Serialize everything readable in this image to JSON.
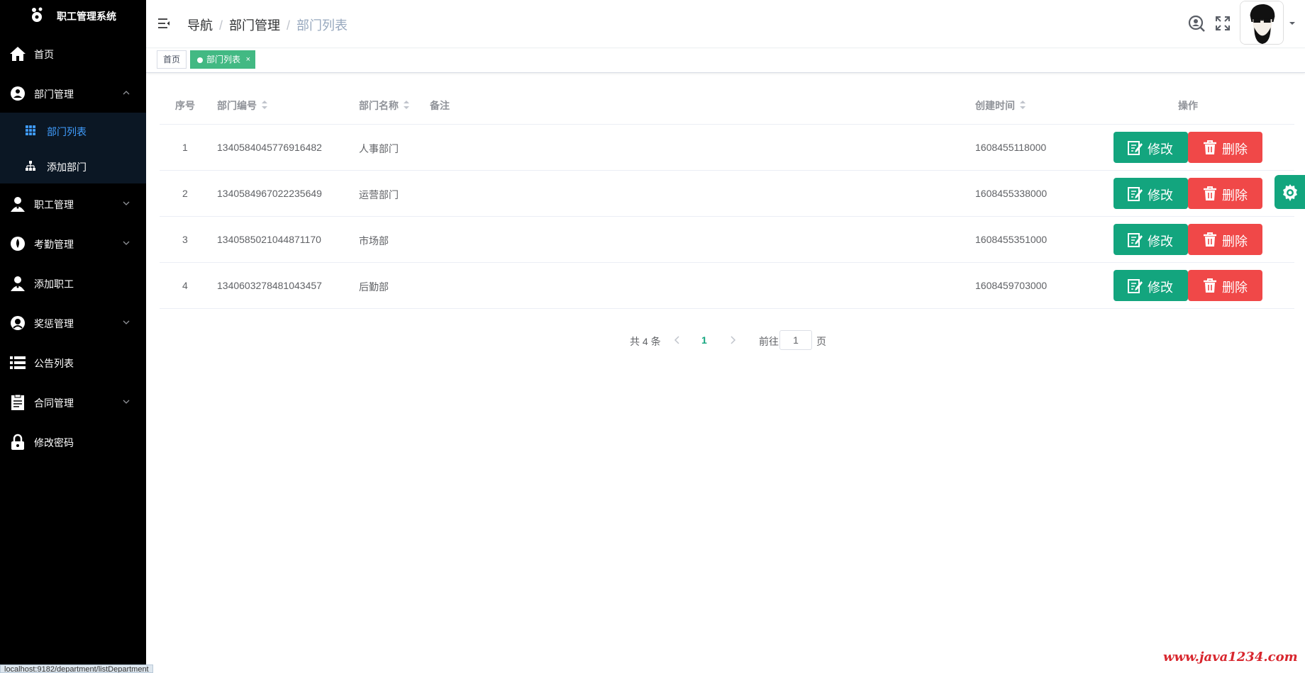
{
  "app": {
    "title": "职工管理系统"
  },
  "sidebar": {
    "items": [
      {
        "label": "首页",
        "icon": "home-icon"
      },
      {
        "label": "部门管理",
        "icon": "department-icon",
        "expanded": true,
        "children": [
          {
            "label": "部门列表",
            "icon": "grid-icon",
            "active": true
          },
          {
            "label": "添加部门",
            "icon": "org-tree-icon"
          }
        ]
      },
      {
        "label": "职工管理",
        "icon": "user-icon"
      },
      {
        "label": "考勤管理",
        "icon": "attendance-icon"
      },
      {
        "label": "添加职工",
        "icon": "user-icon"
      },
      {
        "label": "奖惩管理",
        "icon": "reward-icon"
      },
      {
        "label": "公告列表",
        "icon": "list-icon"
      },
      {
        "label": "合同管理",
        "icon": "contract-icon"
      },
      {
        "label": "修改密码",
        "icon": "lock-icon"
      }
    ]
  },
  "header": {
    "breadcrumb": [
      "导航",
      "部门管理",
      "部门列表"
    ]
  },
  "tags": {
    "home": "首页",
    "active": "部门列表",
    "close": "×"
  },
  "table": {
    "headers": {
      "index": "序号",
      "code": "部门编号",
      "name": "部门名称",
      "remark": "备注",
      "created": "创建时间",
      "actions": "操作"
    },
    "rows": [
      {
        "index": "1",
        "code": "1340584045776916482",
        "name": "人事部门",
        "remark": "",
        "created": "1608455118000"
      },
      {
        "index": "2",
        "code": "1340584967022235649",
        "name": "运营部门",
        "remark": "",
        "created": "1608455338000"
      },
      {
        "index": "3",
        "code": "1340585021044871170",
        "name": "市场部",
        "remark": "",
        "created": "1608455351000"
      },
      {
        "index": "4",
        "code": "1340603278481043457",
        "name": "后勤部",
        "remark": "",
        "created": "1608459703000"
      }
    ],
    "edit_label": "修改",
    "delete_label": "删除"
  },
  "pagination": {
    "total_text": "共 4 条",
    "current": "1",
    "goto_label": "前往",
    "goto_value": "1",
    "page_suffix": "页"
  },
  "status_url": "localhost:9182/department/listDepartment",
  "watermark": "www.java1234.com",
  "colors": {
    "sidebar": "#000000",
    "primary": "#13a57e",
    "danger": "#f04848",
    "active_tag": "#42b983",
    "active_submenu": "#409eff"
  }
}
